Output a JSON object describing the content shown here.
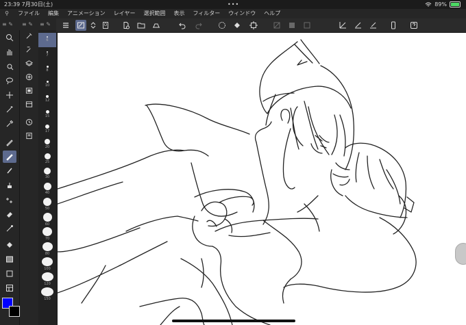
{
  "status": {
    "time": "23:39",
    "date": "7月30日(土)",
    "battery": "89%",
    "battery_level": 0.89
  },
  "menu": [
    "ファイル",
    "編集",
    "アニメーション",
    "レイヤー",
    "選択範囲",
    "表示",
    "フィルター",
    "ウィンドウ",
    "ヘルプ"
  ],
  "toolbar": [
    {
      "name": "menu-icon"
    },
    {
      "name": "brush-size-icon",
      "selected": true
    },
    {
      "name": "swap-icon"
    },
    {
      "name": "brush-display-icon"
    },
    {
      "name": "new-file-icon"
    },
    {
      "name": "open-folder-icon"
    },
    {
      "name": "save-icon"
    },
    {
      "name": "undo-icon"
    },
    {
      "name": "redo-icon",
      "dim": true
    },
    {
      "name": "select-all-icon"
    },
    {
      "name": "fill-icon"
    },
    {
      "name": "crop-icon"
    },
    {
      "name": "clear-icon",
      "dim": true
    },
    {
      "name": "fill-selection-icon",
      "dim": true
    },
    {
      "name": "transform-icon",
      "dim": true
    },
    {
      "name": "ruler-icon"
    },
    {
      "name": "pen-ruler-icon"
    },
    {
      "name": "pencil-ruler-icon"
    },
    {
      "name": "smartphone-icon"
    },
    {
      "name": "help-icon"
    }
  ],
  "tools": [
    {
      "name": "zoom-icon"
    },
    {
      "name": "hand-icon"
    },
    {
      "name": "eyedropper-select-icon"
    },
    {
      "name": "lasso-icon"
    },
    {
      "name": "move-icon"
    },
    {
      "name": "magic-wand-icon"
    },
    {
      "name": "eyedropper-icon"
    },
    {
      "name": "pen-icon"
    },
    {
      "name": "pencil-icon",
      "selected": true
    },
    {
      "name": "brush-icon"
    },
    {
      "name": "airbrush-icon"
    },
    {
      "name": "decoration-icon"
    },
    {
      "name": "eraser-icon"
    },
    {
      "name": "blend-icon"
    },
    {
      "name": "fill-icon"
    },
    {
      "name": "gradient-icon"
    },
    {
      "name": "figure-icon"
    },
    {
      "name": "frame-icon"
    }
  ],
  "subtools": [
    {
      "name": "sub-pen-icon"
    },
    {
      "name": "layer-property-icon"
    },
    {
      "name": "layers-icon"
    },
    {
      "name": "material-icon"
    },
    {
      "name": "navigator-icon"
    },
    {
      "name": "timeline-icon"
    },
    {
      "name": "history-icon"
    },
    {
      "name": "search-icon"
    },
    {
      "name": "auto-action-icon"
    }
  ],
  "brush_sizes": [
    {
      "label": "6",
      "size": 2,
      "selected": true
    },
    {
      "label": "7",
      "size": 2
    },
    {
      "label": "8",
      "size": 3
    },
    {
      "label": "10",
      "size": 3
    },
    {
      "label": "12",
      "size": 4
    },
    {
      "label": "15",
      "size": 5
    },
    {
      "label": "17",
      "size": 6
    },
    {
      "label": "20",
      "size": 8
    },
    {
      "label": "25",
      "size": 9
    },
    {
      "label": "30",
      "size": 10
    },
    {
      "label": "40",
      "size": 11
    },
    {
      "label": "50",
      "size": 12
    },
    {
      "label": "60",
      "size": 13
    },
    {
      "label": "70",
      "size": 14
    },
    {
      "label": "80",
      "size": 15
    },
    {
      "label": "100",
      "size": 16
    },
    {
      "label": "120",
      "size": 17
    },
    {
      "label": "150",
      "size": 18
    }
  ],
  "colors": {
    "main": "#0000ff",
    "sub": "#000000"
  }
}
